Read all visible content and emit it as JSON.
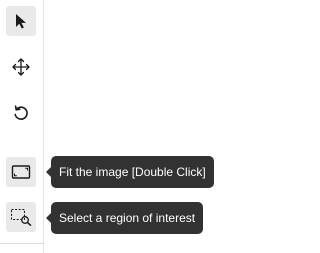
{
  "toolbar": {
    "tools": [
      {
        "name": "Select",
        "icon": "pointer-arrow-icon",
        "active": true
      },
      {
        "name": "Pan",
        "icon": "move-arrows-icon",
        "active": false
      },
      {
        "name": "Reset",
        "icon": "rotate-ccw-icon",
        "active": false
      },
      {
        "name": "Fit the image",
        "icon": "fit-frame-icon",
        "active": true
      },
      {
        "name": "Region of interest",
        "icon": "region-zoom-icon",
        "active": true
      }
    ]
  },
  "tooltips": {
    "fit": "Fit the image [Double Click]",
    "region": "Select a region of interest"
  },
  "colors": {
    "tooltip_bg": "#323232",
    "tooltip_text": "#ffffff",
    "active_bg": "#e9e9e9",
    "icon": "#1a1a1a"
  }
}
